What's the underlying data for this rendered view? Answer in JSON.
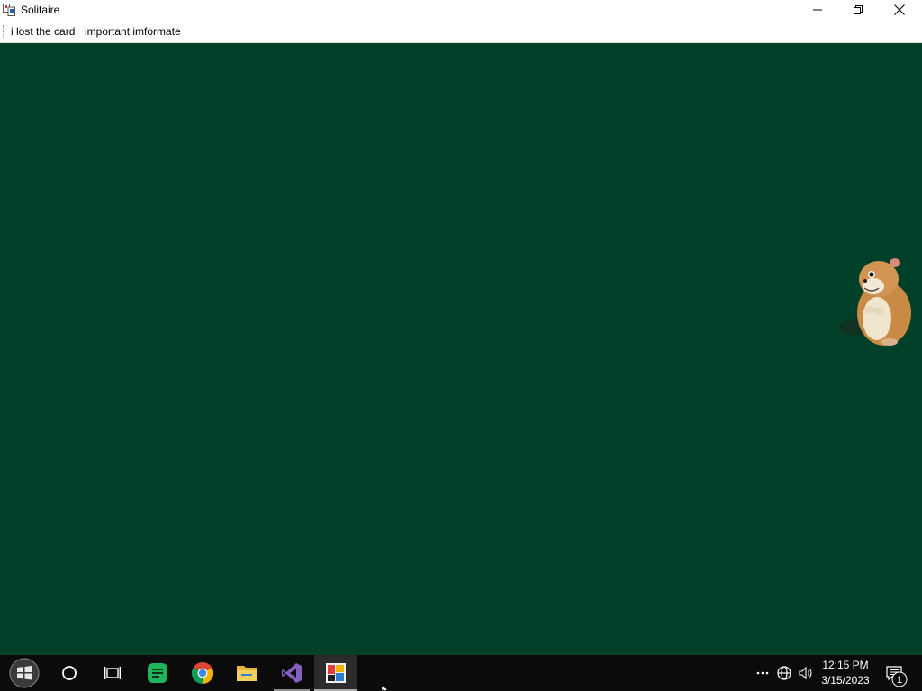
{
  "window": {
    "title": "Solitaire",
    "controls": {
      "minimize": "minimize-icon",
      "maximize": "restore-icon",
      "close": "close-icon"
    }
  },
  "menubar": {
    "items": [
      {
        "label": "i lost the card"
      },
      {
        "label": "important imformate"
      }
    ]
  },
  "game": {
    "background_color": "#003f28",
    "sprite": "hamster-image"
  },
  "taskbar": {
    "pinned": [
      {
        "icon": "start-icon"
      },
      {
        "icon": "search-icon"
      },
      {
        "icon": "task-view-icon"
      },
      {
        "icon": "chat-app-icon"
      },
      {
        "icon": "chrome-icon"
      },
      {
        "icon": "file-explorer-icon"
      },
      {
        "icon": "visual-studio-icon"
      },
      {
        "icon": "solitaire-app-icon"
      }
    ],
    "tray": {
      "icons": [
        "overflow-icon",
        "network-icon",
        "volume-icon"
      ],
      "time": "12:15 PM",
      "date": "3/15/2023",
      "notification_count": "1"
    }
  }
}
